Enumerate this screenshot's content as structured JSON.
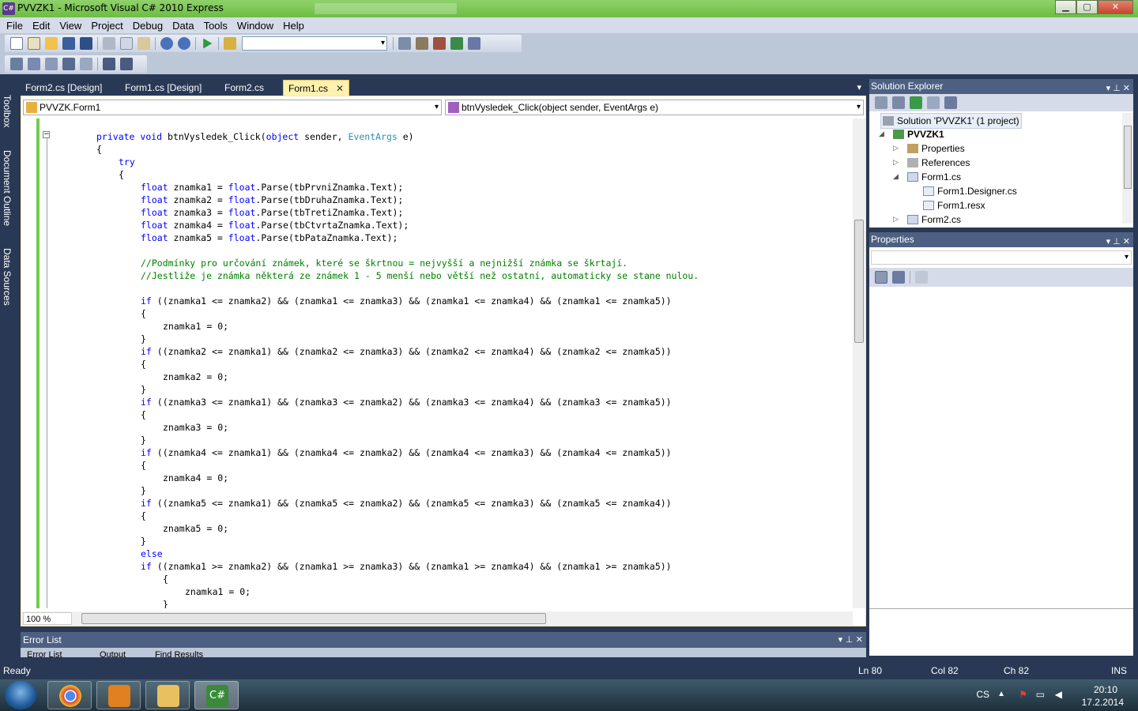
{
  "window": {
    "title": "PVVZK1 - Microsoft Visual C# 2010 Express"
  },
  "menu": [
    "File",
    "Edit",
    "View",
    "Project",
    "Debug",
    "Data",
    "Tools",
    "Window",
    "Help"
  ],
  "left_strip": [
    "Toolbox",
    "Document Outline",
    "Data Sources"
  ],
  "tabs": [
    {
      "label": "Form2.cs [Design]"
    },
    {
      "label": "Form1.cs [Design]"
    },
    {
      "label": "Form2.cs"
    },
    {
      "label": "Form1.cs",
      "active": true,
      "close": "✕"
    }
  ],
  "editor": {
    "class_combo": "PVVZK.Form1",
    "member_combo": "btnVysledek_Click(object sender, EventArgs e)",
    "zoom": "100 %"
  },
  "code_lines": [
    {
      "indent": 0,
      "parts": [
        [
          "kw",
          "private "
        ],
        [
          "kw",
          "void "
        ],
        [
          "",
          "btnVysledek_Click("
        ],
        [
          "kw",
          "object "
        ],
        [
          "",
          "sender, "
        ],
        [
          "ty",
          "EventArgs "
        ],
        [
          "",
          "e)"
        ]
      ]
    },
    {
      "indent": 0,
      "parts": [
        [
          "",
          "{"
        ]
      ]
    },
    {
      "indent": 1,
      "parts": [
        [
          "kw",
          "try"
        ]
      ]
    },
    {
      "indent": 1,
      "parts": [
        [
          "",
          "{"
        ]
      ]
    },
    {
      "indent": 2,
      "parts": [
        [
          "kw",
          "float "
        ],
        [
          "",
          "znamka1 = "
        ],
        [
          "kw",
          "float"
        ],
        [
          "",
          ".Parse(tbPrvniZnamka.Text);"
        ]
      ]
    },
    {
      "indent": 2,
      "parts": [
        [
          "kw",
          "float "
        ],
        [
          "",
          "znamka2 = "
        ],
        [
          "kw",
          "float"
        ],
        [
          "",
          ".Parse(tbDruhaZnamka.Text);"
        ]
      ]
    },
    {
      "indent": 2,
      "parts": [
        [
          "kw",
          "float "
        ],
        [
          "",
          "znamka3 = "
        ],
        [
          "kw",
          "float"
        ],
        [
          "",
          ".Parse(tbTretiZnamka.Text);"
        ]
      ]
    },
    {
      "indent": 2,
      "parts": [
        [
          "kw",
          "float "
        ],
        [
          "",
          "znamka4 = "
        ],
        [
          "kw",
          "float"
        ],
        [
          "",
          ".Parse(tbCtvrtaZnamka.Text);"
        ]
      ]
    },
    {
      "indent": 2,
      "parts": [
        [
          "kw",
          "float "
        ],
        [
          "",
          "znamka5 = "
        ],
        [
          "kw",
          "float"
        ],
        [
          "",
          ".Parse(tbPataZnamka.Text);"
        ]
      ]
    },
    {
      "indent": 2,
      "parts": []
    },
    {
      "indent": 2,
      "parts": [
        [
          "cm",
          "//Podmínky pro určování známek, které se škrtnou = nejvyšší a nejnižší známka se škrtají."
        ]
      ]
    },
    {
      "indent": 2,
      "parts": [
        [
          "cm",
          "//Jestliže je známka některá ze známek 1 - 5 menší nebo větší než ostatní, automaticky se stane nulou."
        ]
      ]
    },
    {
      "indent": 2,
      "parts": []
    },
    {
      "indent": 2,
      "parts": [
        [
          "kw",
          "if "
        ],
        [
          "",
          "((znamka1 <= znamka2) && (znamka1 <= znamka3) && (znamka1 <= znamka4) && (znamka1 <= znamka5))"
        ]
      ]
    },
    {
      "indent": 2,
      "parts": [
        [
          "",
          "{"
        ]
      ]
    },
    {
      "indent": 3,
      "parts": [
        [
          "",
          "znamka1 = 0;"
        ]
      ]
    },
    {
      "indent": 2,
      "parts": [
        [
          "",
          "}"
        ]
      ]
    },
    {
      "indent": 2,
      "parts": [
        [
          "kw",
          "if "
        ],
        [
          "",
          "((znamka2 <= znamka1) && (znamka2 <= znamka3) && (znamka2 <= znamka4) && (znamka2 <= znamka5))"
        ]
      ]
    },
    {
      "indent": 2,
      "parts": [
        [
          "",
          "{"
        ]
      ]
    },
    {
      "indent": 3,
      "parts": [
        [
          "",
          "znamka2 = 0;"
        ]
      ]
    },
    {
      "indent": 2,
      "parts": [
        [
          "",
          "}"
        ]
      ]
    },
    {
      "indent": 2,
      "parts": [
        [
          "kw",
          "if "
        ],
        [
          "",
          "((znamka3 <= znamka1) && (znamka3 <= znamka2) && (znamka3 <= znamka4) && (znamka3 <= znamka5))"
        ]
      ]
    },
    {
      "indent": 2,
      "parts": [
        [
          "",
          "{"
        ]
      ]
    },
    {
      "indent": 3,
      "parts": [
        [
          "",
          "znamka3 = 0;"
        ]
      ]
    },
    {
      "indent": 2,
      "parts": [
        [
          "",
          "}"
        ]
      ]
    },
    {
      "indent": 2,
      "parts": [
        [
          "kw",
          "if "
        ],
        [
          "",
          "((znamka4 <= znamka1) && (znamka4 <= znamka2) && (znamka4 <= znamka3) && (znamka4 <= znamka5))"
        ]
      ]
    },
    {
      "indent": 2,
      "parts": [
        [
          "",
          "{"
        ]
      ]
    },
    {
      "indent": 3,
      "parts": [
        [
          "",
          "znamka4 = 0;"
        ]
      ]
    },
    {
      "indent": 2,
      "parts": [
        [
          "",
          "}"
        ]
      ]
    },
    {
      "indent": 2,
      "parts": [
        [
          "kw",
          "if "
        ],
        [
          "",
          "((znamka5 <= znamka1) && (znamka5 <= znamka2) && (znamka5 <= znamka3) && (znamka5 <= znamka4))"
        ]
      ]
    },
    {
      "indent": 2,
      "parts": [
        [
          "",
          "{"
        ]
      ]
    },
    {
      "indent": 3,
      "parts": [
        [
          "",
          "znamka5 = 0;"
        ]
      ]
    },
    {
      "indent": 2,
      "parts": [
        [
          "",
          "}"
        ]
      ]
    },
    {
      "indent": 2,
      "parts": [
        [
          "kw",
          "else"
        ]
      ]
    },
    {
      "indent": 2,
      "parts": [
        [
          "kw",
          "if "
        ],
        [
          "",
          "((znamka1 >= znamka2) && (znamka1 >= znamka3) && (znamka1 >= znamka4) && (znamka1 >= znamka5))"
        ]
      ]
    },
    {
      "indent": 3,
      "parts": [
        [
          "",
          "{"
        ]
      ]
    },
    {
      "indent": 4,
      "parts": [
        [
          "",
          "znamka1 = 0;"
        ]
      ]
    },
    {
      "indent": 3,
      "parts": [
        [
          "",
          "}"
        ]
      ]
    }
  ],
  "error_list": {
    "title": "Error List",
    "tabs": [
      "Error List",
      "Output",
      "Find Results"
    ]
  },
  "solution_explorer": {
    "title": "Solution Explorer",
    "items": [
      {
        "label": "Solution 'PVVZK1' (1 project)"
      },
      {
        "label": "PVVZK1"
      },
      {
        "label": "Properties"
      },
      {
        "label": "References"
      },
      {
        "label": "Form1.cs"
      },
      {
        "label": "Form1.Designer.cs"
      },
      {
        "label": "Form1.resx"
      },
      {
        "label": "Form2.cs"
      }
    ]
  },
  "properties": {
    "title": "Properties"
  },
  "pane_buttons": "▾ ⊥ ✕",
  "status": {
    "text": "Ready",
    "ln": "Ln 80",
    "col": "Col 82",
    "ch": "Ch 82",
    "mode": "INS"
  },
  "taskbar": {
    "lang": "CS",
    "time": "20:10",
    "date": "17.2.2014",
    "vs_icon_label": "C#"
  },
  "window_buttons": {
    "minimize": "▁",
    "maximize": "▢",
    "close": "✕"
  },
  "colors": {
    "keyword": "#0000ff",
    "type": "#2b91af",
    "comment": "#008000",
    "panel_header": "#4d6082",
    "ide_background": "#293955"
  }
}
